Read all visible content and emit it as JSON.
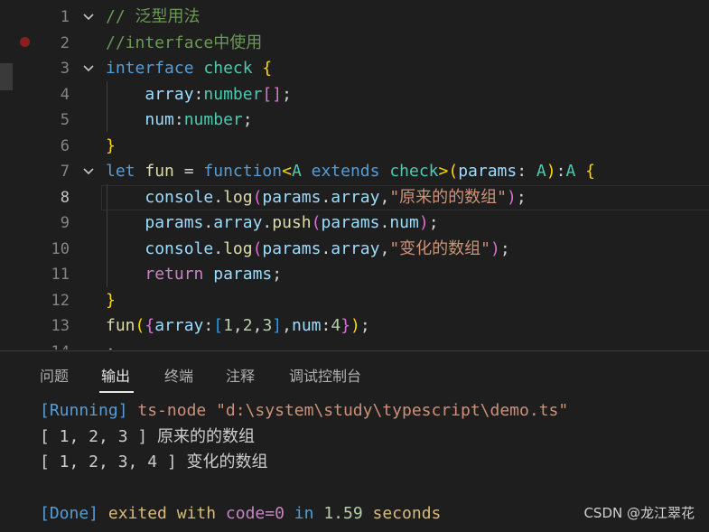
{
  "editor": {
    "lines": [
      {
        "num": "1",
        "fold": true,
        "tokens": [
          [
            "// 泛型用法",
            "cm"
          ]
        ]
      },
      {
        "num": "2",
        "fold": false,
        "tokens": [
          [
            "//interface中使用",
            "cm"
          ]
        ]
      },
      {
        "num": "3",
        "fold": true,
        "tokens": [
          [
            "interface",
            "kw"
          ],
          [
            " ",
            "pu"
          ],
          [
            "check",
            "ty"
          ],
          [
            " ",
            "pu"
          ],
          [
            "{",
            "b1"
          ]
        ]
      },
      {
        "num": "4",
        "fold": false,
        "indent": true,
        "tokens": [
          [
            "    ",
            "pu"
          ],
          [
            "array",
            "id"
          ],
          [
            ":",
            "pu"
          ],
          [
            "number",
            "ty"
          ],
          [
            "[]",
            "b2"
          ],
          [
            ";",
            "pu"
          ]
        ]
      },
      {
        "num": "5",
        "fold": false,
        "indent": true,
        "tokens": [
          [
            "    ",
            "pu"
          ],
          [
            "num",
            "id"
          ],
          [
            ":",
            "pu"
          ],
          [
            "number",
            "ty"
          ],
          [
            ";",
            "pu"
          ]
        ]
      },
      {
        "num": "6",
        "fold": false,
        "tokens": [
          [
            "}",
            "b1"
          ]
        ]
      },
      {
        "num": "7",
        "fold": true,
        "tokens": [
          [
            "let",
            "kw"
          ],
          [
            " ",
            "pu"
          ],
          [
            "fun",
            "fn"
          ],
          [
            " = ",
            "pu"
          ],
          [
            "function",
            "kw"
          ],
          [
            "<",
            "b1"
          ],
          [
            "A",
            "ty"
          ],
          [
            " ",
            "pu"
          ],
          [
            "extends",
            "kw"
          ],
          [
            " ",
            "pu"
          ],
          [
            "check",
            "ty"
          ],
          [
            ">",
            "b1"
          ],
          [
            "(",
            "b1"
          ],
          [
            "params",
            "id"
          ],
          [
            ": ",
            "pu"
          ],
          [
            "A",
            "ty"
          ],
          [
            ")",
            "b1"
          ],
          [
            ":",
            "pu"
          ],
          [
            "A",
            "ty"
          ],
          [
            " ",
            "pu"
          ],
          [
            "{",
            "b1"
          ]
        ]
      },
      {
        "num": "8",
        "fold": false,
        "active": true,
        "indent": true,
        "tokens": [
          [
            "    ",
            "pu"
          ],
          [
            "console",
            "id"
          ],
          [
            ".",
            "pu"
          ],
          [
            "log",
            "fn"
          ],
          [
            "(",
            "b2"
          ],
          [
            "params",
            "id"
          ],
          [
            ".",
            "pu"
          ],
          [
            "array",
            "id"
          ],
          [
            ",",
            "pu"
          ],
          [
            "\"原来的的数组\"",
            "st"
          ],
          [
            ")",
            "b2"
          ],
          [
            ";",
            "pu"
          ]
        ]
      },
      {
        "num": "9",
        "fold": false,
        "indent": true,
        "tokens": [
          [
            "    ",
            "pu"
          ],
          [
            "params",
            "id"
          ],
          [
            ".",
            "pu"
          ],
          [
            "array",
            "id"
          ],
          [
            ".",
            "pu"
          ],
          [
            "push",
            "fn"
          ],
          [
            "(",
            "b2"
          ],
          [
            "params",
            "id"
          ],
          [
            ".",
            "pu"
          ],
          [
            "num",
            "id"
          ],
          [
            ")",
            "b2"
          ],
          [
            ";",
            "pu"
          ]
        ]
      },
      {
        "num": "10",
        "fold": false,
        "indent": true,
        "tokens": [
          [
            "    ",
            "pu"
          ],
          [
            "console",
            "id"
          ],
          [
            ".",
            "pu"
          ],
          [
            "log",
            "fn"
          ],
          [
            "(",
            "b2"
          ],
          [
            "params",
            "id"
          ],
          [
            ".",
            "pu"
          ],
          [
            "array",
            "id"
          ],
          [
            ",",
            "pu"
          ],
          [
            "\"变化的数组\"",
            "st"
          ],
          [
            ")",
            "b2"
          ],
          [
            ";",
            "pu"
          ]
        ]
      },
      {
        "num": "11",
        "fold": false,
        "indent": true,
        "tokens": [
          [
            "    ",
            "pu"
          ],
          [
            "return",
            "ret"
          ],
          [
            " ",
            "pu"
          ],
          [
            "params",
            "id"
          ],
          [
            ";",
            "pu"
          ]
        ]
      },
      {
        "num": "12",
        "fold": false,
        "tokens": [
          [
            "}",
            "b1"
          ]
        ]
      },
      {
        "num": "13",
        "fold": false,
        "tokens": [
          [
            "fun",
            "fn"
          ],
          [
            "(",
            "b1"
          ],
          [
            "{",
            "b2"
          ],
          [
            "array",
            "id"
          ],
          [
            ":",
            "pu"
          ],
          [
            "[",
            "b3"
          ],
          [
            "1",
            "nm"
          ],
          [
            ",",
            "pu"
          ],
          [
            "2",
            "nm"
          ],
          [
            ",",
            "pu"
          ],
          [
            "3",
            "nm"
          ],
          [
            "]",
            "b3"
          ],
          [
            ",",
            "pu"
          ],
          [
            "num",
            "id"
          ],
          [
            ":",
            "pu"
          ],
          [
            "4",
            "nm"
          ],
          [
            "}",
            "b2"
          ],
          [
            ")",
            "b1"
          ],
          [
            ";",
            "pu"
          ]
        ]
      },
      {
        "num": "14",
        "fold": false,
        "tokens": [
          [
            ";",
            "pu"
          ]
        ]
      }
    ]
  },
  "panel": {
    "tabs": [
      {
        "label": "问题",
        "active": false
      },
      {
        "label": "输出",
        "active": true
      },
      {
        "label": "终端",
        "active": false
      },
      {
        "label": "注释",
        "active": false
      },
      {
        "label": "调试控制台",
        "active": false
      }
    ],
    "output": [
      [
        [
          "[Running]",
          "o-blue"
        ],
        [
          " ts-node \"d:\\system\\study\\typescript\\demo.ts\"",
          "o-orange"
        ]
      ],
      [
        [
          "[ 1, 2, 3 ] 原来的的数组",
          ""
        ]
      ],
      [
        [
          "[ 1, 2, 3, 4 ] 变化的数组",
          ""
        ]
      ],
      [],
      [
        [
          "[Done]",
          "o-blue"
        ],
        [
          " exited with ",
          "o-dark-orange"
        ],
        [
          "code=0",
          "o-purple"
        ],
        [
          " in ",
          "o-blue"
        ],
        [
          "1.59",
          "o-green"
        ],
        [
          " seconds",
          "o-dark-orange"
        ]
      ]
    ]
  },
  "watermark": "CSDN @龙江翠花"
}
